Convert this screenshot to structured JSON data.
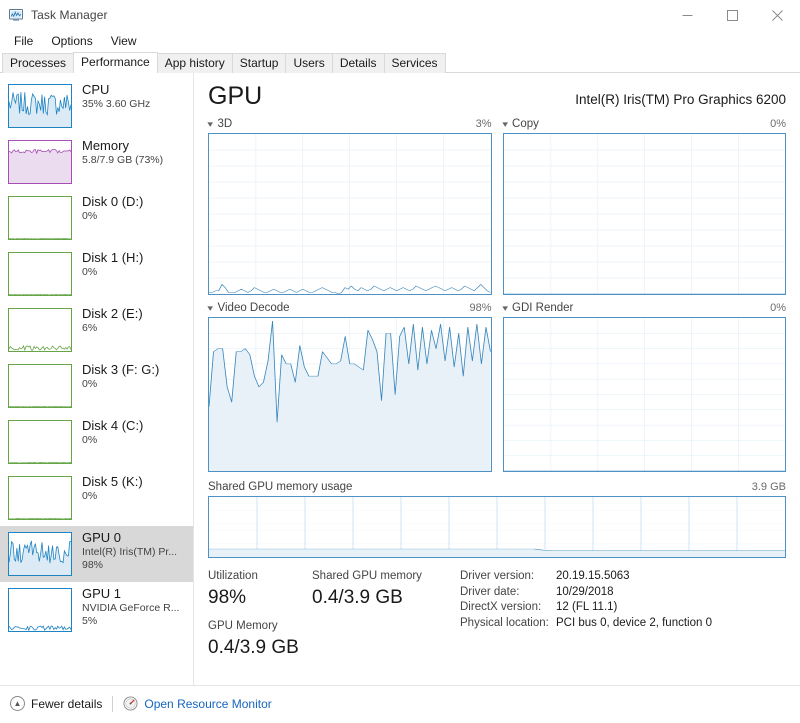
{
  "window": {
    "title": "Task Manager",
    "icon": "task-manager-icon",
    "minimize": "—",
    "maximize": "☐",
    "close": "✕"
  },
  "menu": [
    "File",
    "Options",
    "View"
  ],
  "tabs": [
    {
      "label": "Processes",
      "active": false
    },
    {
      "label": "Performance",
      "active": true
    },
    {
      "label": "App history",
      "active": false
    },
    {
      "label": "Startup",
      "active": false
    },
    {
      "label": "Users",
      "active": false
    },
    {
      "label": "Details",
      "active": false
    },
    {
      "label": "Services",
      "active": false
    }
  ],
  "sidebar": {
    "items": [
      {
        "title": "CPU",
        "sub1": "35%  3.60 GHz",
        "sub2": "",
        "color": "#1f84c4",
        "fill": "#dbeaf4",
        "selected": false,
        "activity": "busy"
      },
      {
        "title": "Memory",
        "sub1": "5.8/7.9 GB (73%)",
        "sub2": "",
        "color": "#a44eb5",
        "fill": "#ecdcef",
        "selected": false,
        "activity": "flat-high"
      },
      {
        "title": "Disk 0 (D:)",
        "sub1": "0%",
        "sub2": "",
        "color": "#65a547",
        "fill": "#e4f0de",
        "selected": false,
        "activity": "idle"
      },
      {
        "title": "Disk 1 (H:)",
        "sub1": "0%",
        "sub2": "",
        "color": "#65a547",
        "fill": "#e4f0de",
        "selected": false,
        "activity": "idle"
      },
      {
        "title": "Disk 2 (E:)",
        "sub1": "6%",
        "sub2": "",
        "color": "#65a547",
        "fill": "#e4f0de",
        "selected": false,
        "activity": "low"
      },
      {
        "title": "Disk 3 (F: G:)",
        "sub1": "0%",
        "sub2": "",
        "color": "#65a547",
        "fill": "#e4f0de",
        "selected": false,
        "activity": "idle"
      },
      {
        "title": "Disk 4 (C:)",
        "sub1": "0%",
        "sub2": "",
        "color": "#65a547",
        "fill": "#e4f0de",
        "selected": false,
        "activity": "idle"
      },
      {
        "title": "Disk 5 (K:)",
        "sub1": "0%",
        "sub2": "",
        "color": "#65a547",
        "fill": "#e4f0de",
        "selected": false,
        "activity": "idle"
      },
      {
        "title": "GPU 0",
        "sub1": "Intel(R) Iris(TM) Pr...",
        "sub2": "98%",
        "color": "#1f84c4",
        "fill": "#dbeaf4",
        "selected": true,
        "activity": "busy"
      },
      {
        "title": "GPU 1",
        "sub1": "NVIDIA GeForce R...",
        "sub2": "5%",
        "color": "#1f84c4",
        "fill": "#dbeaf4",
        "selected": false,
        "activity": "low"
      }
    ]
  },
  "main": {
    "heading": "GPU",
    "model": "Intel(R) Iris(TM) Pro Graphics 6200",
    "engines": [
      {
        "name": "3D",
        "percent": "3%"
      },
      {
        "name": "Copy",
        "percent": "0%"
      },
      {
        "name": "Video Decode",
        "percent": "98%"
      },
      {
        "name": "GDI Render",
        "percent": "0%"
      }
    ],
    "shared_memory_graph": {
      "label": "Shared GPU memory usage",
      "max": "3.9 GB"
    },
    "stats": {
      "utilization_label": "Utilization",
      "utilization_value": "98%",
      "gpu_memory_label": "GPU Memory",
      "gpu_memory_value": "0.4/3.9 GB",
      "shared_label": "Shared GPU memory",
      "shared_value": "0.4/3.9 GB"
    },
    "info": [
      {
        "key": "Driver version:",
        "value": "20.19.15.5063"
      },
      {
        "key": "Driver date:",
        "value": "10/29/2018"
      },
      {
        "key": "DirectX version:",
        "value": "12 (FL 11.1)"
      },
      {
        "key": "Physical location:",
        "value": "PCI bus 0, device 2, function 0"
      }
    ]
  },
  "footer": {
    "fewer_details": "Fewer details",
    "open_resource_monitor": "Open Resource Monitor"
  },
  "colors": {
    "accent_blue": "#1f84c4",
    "graph_border": "#4e91c4",
    "graph_fill": "#e8f1f7",
    "grid": "#cfe3f0",
    "link": "#1565c0",
    "selected_row": "#d8d8d8"
  },
  "chart_data": [
    {
      "type": "line",
      "title": "3D",
      "ylabel": "Utilization",
      "ylim": [
        0,
        100
      ],
      "current_value": 3,
      "grid": true,
      "values": [
        1,
        1,
        2,
        2,
        6,
        4,
        1,
        1,
        1,
        2,
        3,
        2,
        1,
        2,
        4,
        3,
        2,
        1,
        1,
        2,
        3,
        2,
        1,
        1,
        2,
        3,
        2,
        1,
        2,
        3,
        2,
        1,
        1,
        2,
        3,
        4,
        3,
        2,
        1,
        1,
        0,
        1,
        4,
        3,
        5,
        3,
        2,
        4,
        3,
        2,
        3,
        5,
        4,
        3,
        2,
        3,
        4,
        3,
        2,
        3,
        4,
        3,
        2,
        3,
        5,
        4,
        3,
        2,
        3,
        4,
        5,
        4,
        3,
        2,
        3,
        4,
        3,
        2,
        3,
        5,
        4,
        3,
        2,
        4,
        6,
        4,
        2,
        1
      ]
    },
    {
      "type": "line",
      "title": "Copy",
      "ylabel": "Utilization",
      "ylim": [
        0,
        100
      ],
      "current_value": 0,
      "grid": true,
      "values": [
        0,
        0,
        0,
        0,
        0,
        0,
        0,
        0,
        0,
        0,
        0,
        0,
        0,
        0,
        0,
        0,
        0,
        0,
        0,
        0,
        0,
        0,
        0,
        0,
        0,
        0,
        0,
        0,
        0,
        0,
        0,
        0,
        0,
        0,
        0,
        0,
        0,
        0,
        0,
        0,
        0,
        0,
        0,
        0,
        0,
        0,
        0,
        0,
        0,
        0,
        0,
        0,
        0,
        0,
        0,
        0,
        0,
        0,
        0,
        0
      ]
    },
    {
      "type": "area",
      "title": "Video Decode",
      "ylabel": "Utilization",
      "ylim": [
        0,
        100
      ],
      "current_value": 98,
      "grid": true,
      "values": [
        42,
        78,
        80,
        80,
        55,
        45,
        78,
        78,
        80,
        76,
        62,
        55,
        58,
        72,
        98,
        32,
        76,
        70,
        70,
        58,
        82,
        68,
        62,
        62,
        62,
        78,
        74,
        70,
        70,
        72,
        88,
        70,
        70,
        68,
        66,
        92,
        86,
        78,
        46,
        90,
        90,
        50,
        88,
        94,
        70,
        96,
        66,
        94,
        70,
        92,
        80,
        96,
        72,
        94,
        68,
        90,
        62,
        94,
        72,
        96,
        70,
        94,
        78
      ]
    },
    {
      "type": "line",
      "title": "GDI Render",
      "ylabel": "Utilization",
      "ylim": [
        0,
        100
      ],
      "current_value": 0,
      "grid": true,
      "values": [
        0,
        0,
        0,
        0,
        0,
        0,
        0,
        0,
        0,
        0,
        0,
        0,
        0,
        0,
        0,
        0,
        0,
        0,
        0,
        0,
        0,
        0,
        0,
        0,
        0,
        0,
        0,
        0,
        0,
        0,
        0,
        0,
        0,
        0,
        0,
        0,
        0,
        0,
        0,
        0,
        0,
        0,
        0,
        0,
        0,
        0,
        0,
        0,
        0,
        0,
        0,
        0,
        0,
        0,
        0,
        0,
        0,
        0,
        0,
        0
      ]
    },
    {
      "type": "area",
      "title": "Shared GPU memory usage",
      "ylabel": "GB",
      "ylim": [
        0,
        3.9
      ],
      "current_value": 0.4,
      "grid": true,
      "values": [
        0.52,
        0.52,
        0.52,
        0.52,
        0.52,
        0.52,
        0.52,
        0.52,
        0.52,
        0.52,
        0.52,
        0.52,
        0.52,
        0.52,
        0.52,
        0.52,
        0.52,
        0.52,
        0.52,
        0.52,
        0.52,
        0.52,
        0.52,
        0.52,
        0.52,
        0.52,
        0.52,
        0.52,
        0.52,
        0.52,
        0.52,
        0.52,
        0.52,
        0.52,
        0.52,
        0.52,
        0.52,
        0.52,
        0.52,
        0.52,
        0.45,
        0.4,
        0.4,
        0.4,
        0.4,
        0.4,
        0.4,
        0.4,
        0.4,
        0.4,
        0.4,
        0.4,
        0.4,
        0.4,
        0.4,
        0.4,
        0.4,
        0.4,
        0.4,
        0.4,
        0.4,
        0.4,
        0.4,
        0.4,
        0.4,
        0.4,
        0.4,
        0.4,
        0.4,
        0.4
      ]
    }
  ]
}
